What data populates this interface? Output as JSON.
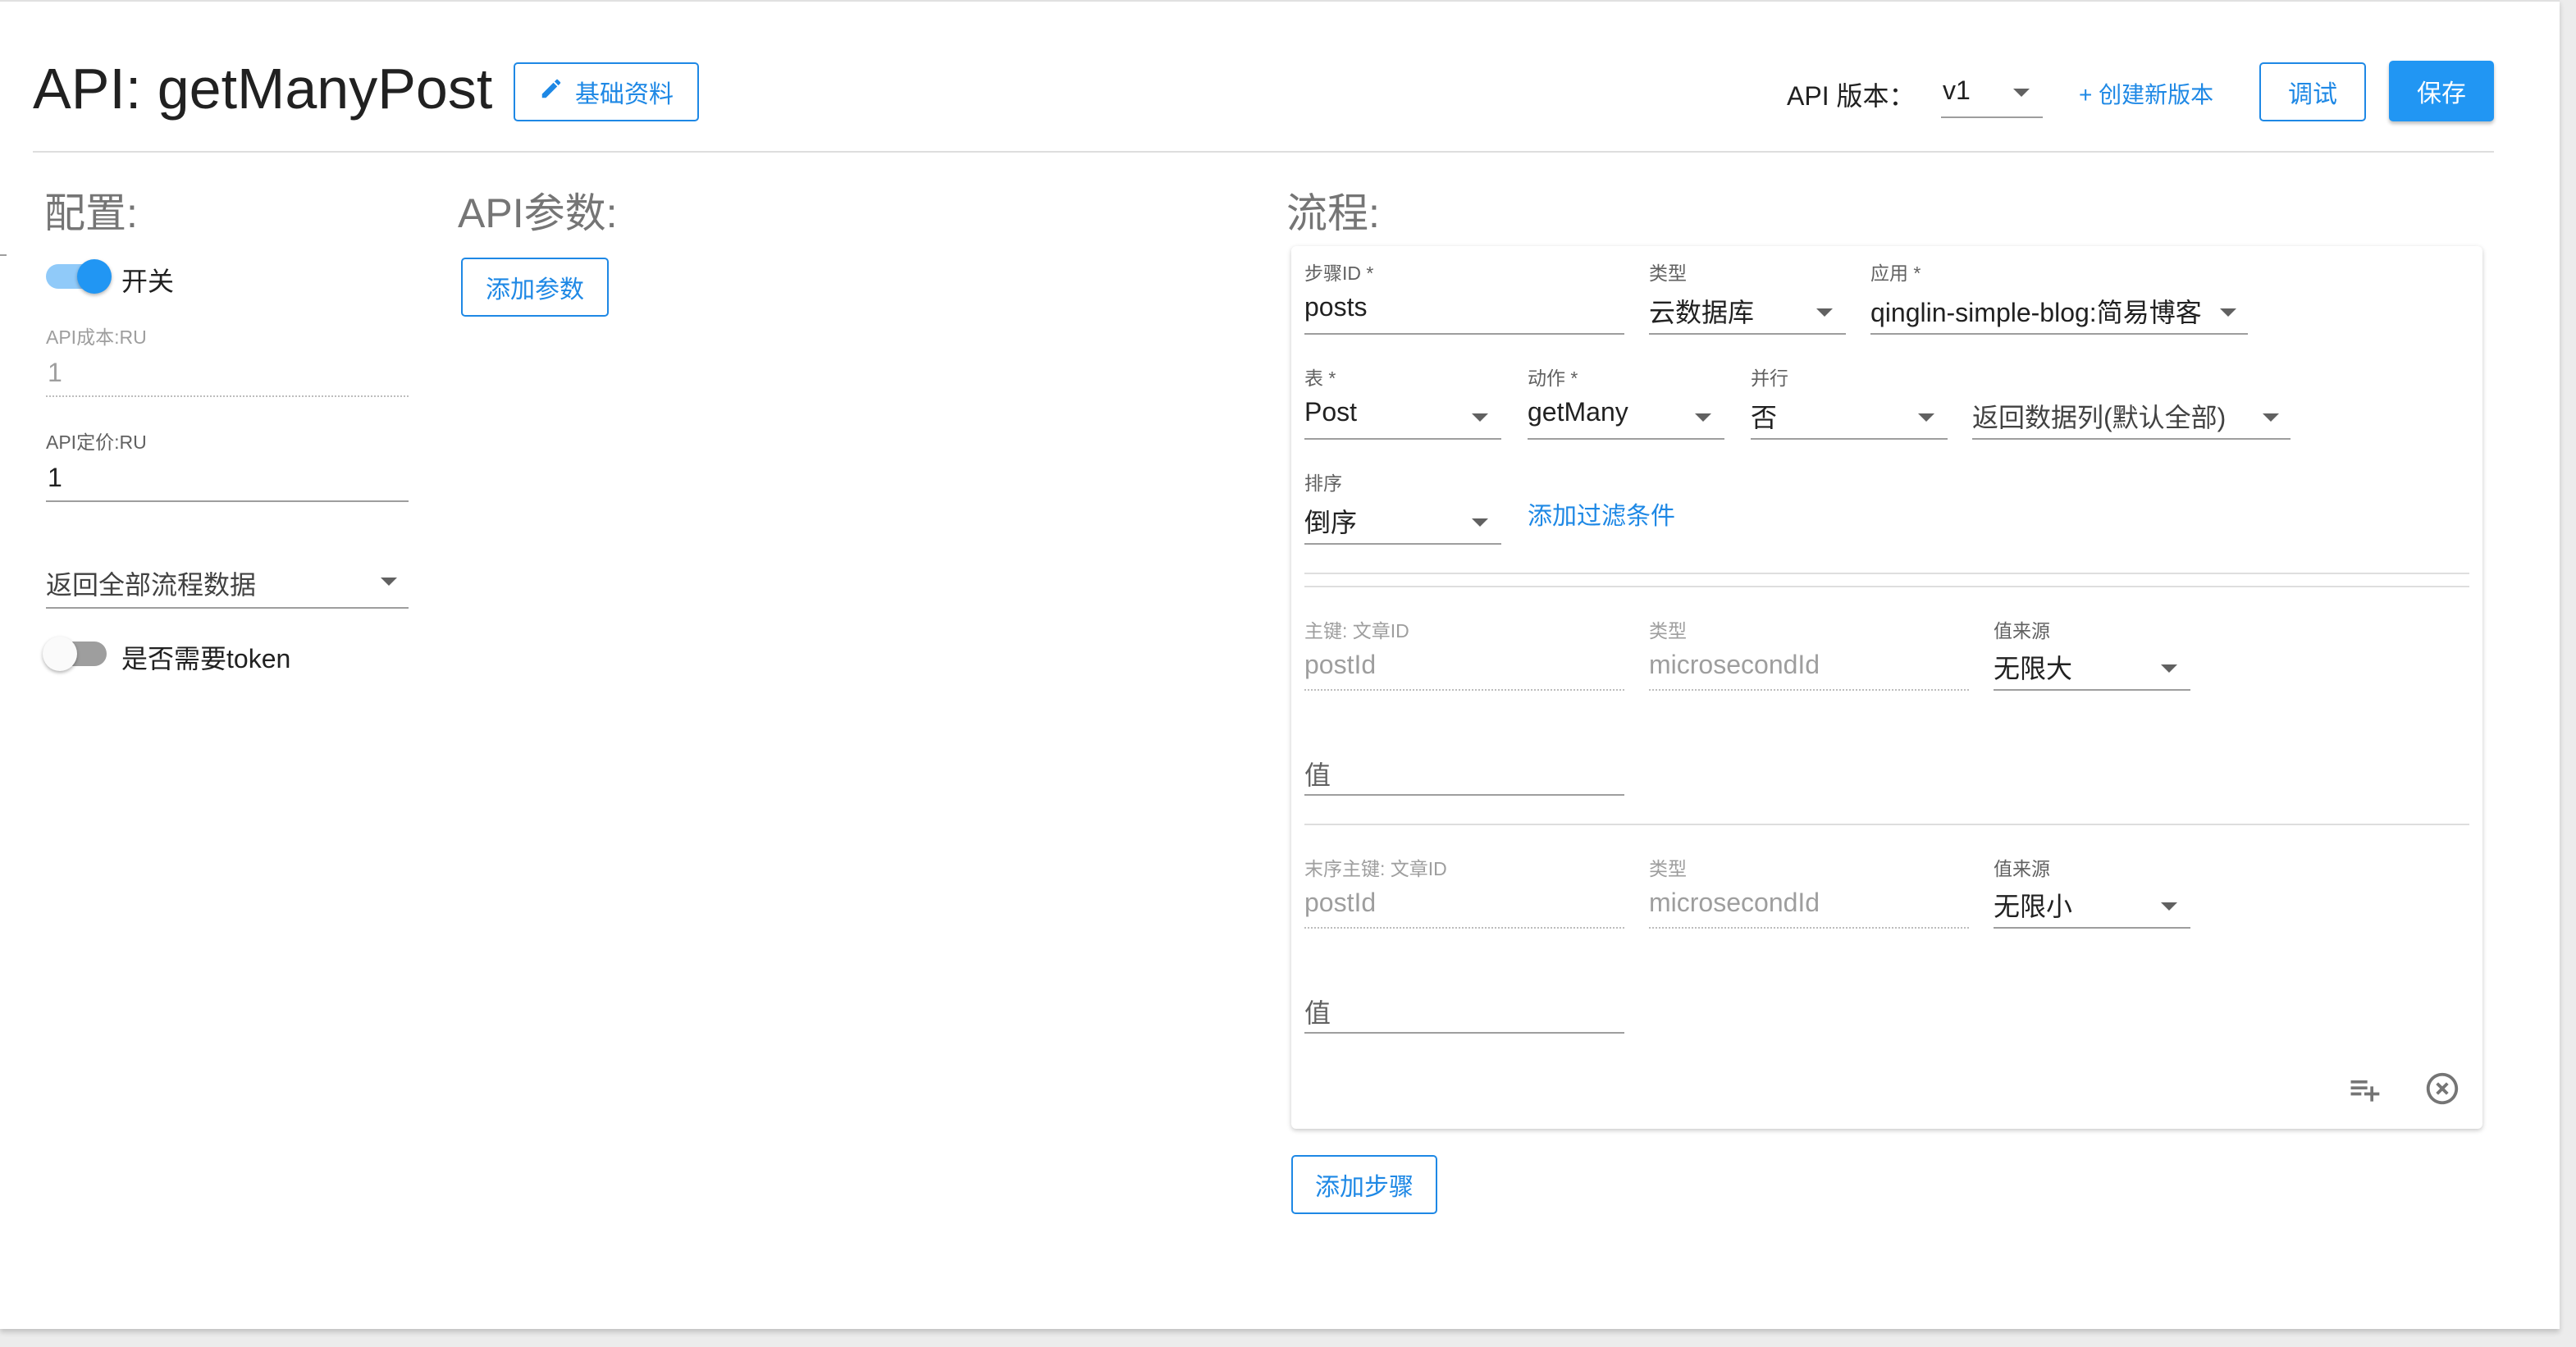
{
  "header": {
    "title": "API: getManyPost",
    "basic_info_label": "基础资料",
    "version_label": "API 版本：",
    "version_value": "v1",
    "create_version_label": "+ 创建新版本",
    "debug_label": "调试",
    "save_label": "保存"
  },
  "config": {
    "title": "配置:",
    "toggle_label": "开关",
    "toggle_on": true,
    "cost_label": "API成本:RU",
    "cost_value": "1",
    "price_label": "API定价:RU",
    "price_value": "1",
    "return_select_value": "返回全部流程数据",
    "token_label": "是否需要token",
    "token_on": false
  },
  "params": {
    "title": "API参数:",
    "add_param_label": "添加参数"
  },
  "flow": {
    "title": "流程:",
    "step": {
      "step_id_label": "步骤ID *",
      "step_id_value": "posts",
      "type_label": "类型",
      "type_value": "云数据库",
      "app_label": "应用 *",
      "app_value": "qinglin-simple-blog:简易博客",
      "table_label": "表 *",
      "table_value": "Post",
      "action_label": "动作 *",
      "action_value": "getMany",
      "parallel_label": "并行",
      "parallel_value": "否",
      "return_columns_value": "返回数据列(默认全部)",
      "sort_label": "排序",
      "sort_value": "倒序",
      "add_filter_label": "添加过滤条件",
      "primary_key": {
        "key_label": "主键: 文章ID",
        "key_value": "postId",
        "type_label": "类型",
        "type_value": "microsecondId",
        "source_label": "值来源",
        "source_value": "无限大",
        "value_placeholder": "值"
      },
      "end_key": {
        "key_label": "末序主键: 文章ID",
        "key_value": "postId",
        "type_label": "类型",
        "type_value": "microsecondId",
        "source_label": "值来源",
        "source_value": "无限小",
        "value_placeholder": "值"
      }
    },
    "add_step_label": "添加步骤"
  },
  "colors": {
    "accent": "#2196f3",
    "link": "#1e88e5"
  },
  "icons": [
    "pencil-icon",
    "playlist-add-icon",
    "close-circle-icon"
  ]
}
